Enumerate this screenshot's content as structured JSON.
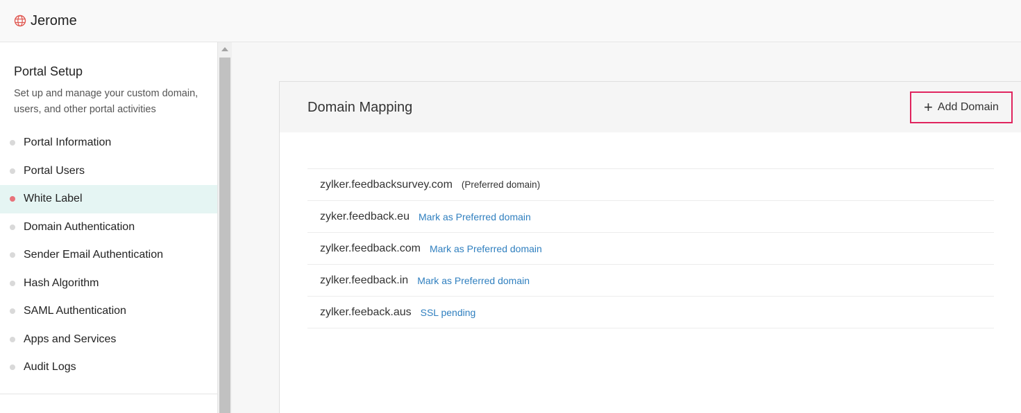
{
  "app": {
    "name": "Jerome"
  },
  "sidebar": {
    "title": "Portal Setup",
    "description": "Set up and manage your custom domain, users, and other portal activities",
    "items": [
      {
        "label": "Portal Information"
      },
      {
        "label": "Portal Users"
      },
      {
        "label": "White Label",
        "active": true
      },
      {
        "label": "Domain Authentication"
      },
      {
        "label": "Sender Email Authentication"
      },
      {
        "label": "Hash Algorithm"
      },
      {
        "label": "SAML Authentication"
      },
      {
        "label": "Apps and Services"
      },
      {
        "label": "Audit Logs"
      }
    ]
  },
  "panel": {
    "title": "Domain Mapping",
    "add_button": {
      "icon": "plus-icon",
      "label": "Add Domain"
    },
    "domains": [
      {
        "name": "zylker.feedbacksurvey.com",
        "note": "(Preferred domain)"
      },
      {
        "name": "zyker.feedback.eu",
        "action": "Mark as Preferred domain"
      },
      {
        "name": "zylker.feedback.com",
        "action": "Mark as Preferred domain"
      },
      {
        "name": "zylker.feedback.in",
        "action": "Mark as Preferred domain"
      },
      {
        "name": "zylker.feeback.aus",
        "action": "SSL pending"
      }
    ]
  },
  "colors": {
    "brand_icon": "#e0564f",
    "active_dot": "#e8727a",
    "active_bg": "#e5f5f3",
    "link": "#2f7fbf",
    "highlight_border": "#e0245e"
  },
  "icons": {
    "brand": "globe-icon",
    "scroll_up": "arrow-up-icon"
  }
}
